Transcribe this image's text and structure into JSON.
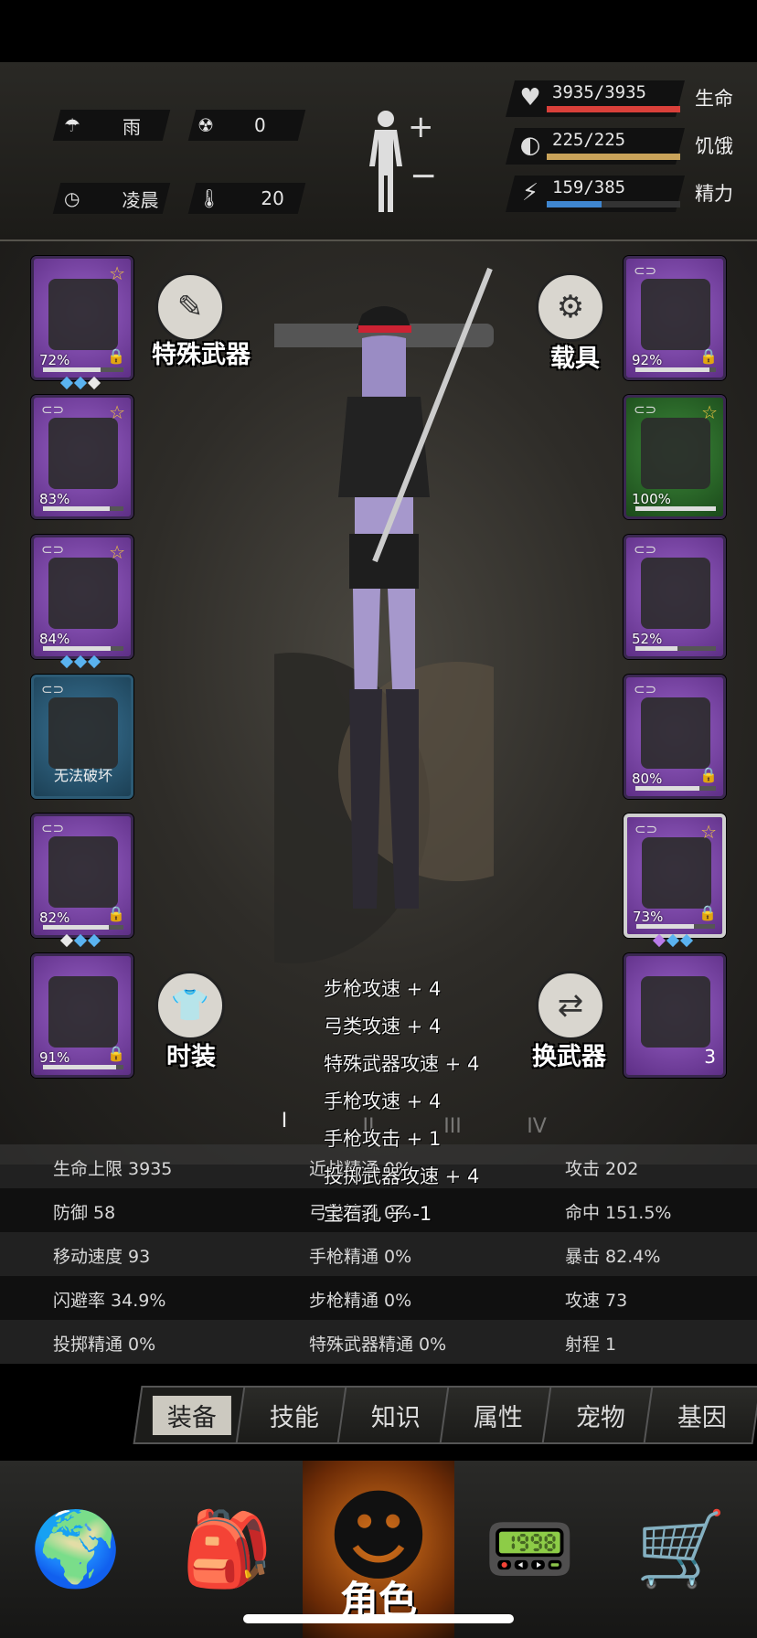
{
  "top": {
    "weather": {
      "icon": "rain-icon",
      "label": "雨"
    },
    "radiation": {
      "icon": "radiation-icon",
      "value": "0"
    },
    "time": {
      "icon": "clock-icon",
      "label": "凌晨"
    },
    "temperature": {
      "icon": "thermometer-icon",
      "value": "20"
    },
    "vitals": [
      {
        "name": "生命",
        "text": "3935/3935",
        "ratio": 1.0,
        "color": "#d9403a",
        "icon": "heart-icon"
      },
      {
        "name": "饥饿",
        "text": "225/225",
        "ratio": 1.0,
        "color": "#c9a35a",
        "icon": "stomach-icon"
      },
      {
        "name": "精力",
        "text": "159/385",
        "ratio": 0.41,
        "color": "#3f86d0",
        "icon": "energy-icon"
      }
    ]
  },
  "slots_left": [
    {
      "name": "helmet-slot",
      "pct": "72%",
      "durability": 0.72,
      "star": true,
      "lock": true,
      "gems": [
        "blue",
        "blue",
        "white"
      ]
    },
    {
      "name": "shirt-slot",
      "pct": "83%",
      "durability": 0.83,
      "star": true,
      "link": true
    },
    {
      "name": "jacket-slot",
      "pct": "84%",
      "durability": 0.84,
      "star": true,
      "link": true,
      "gems": [
        "blue",
        "blue",
        "blue"
      ]
    },
    {
      "name": "backpack-slot",
      "pct": "",
      "text": "无法破坏",
      "link": true
    },
    {
      "name": "pants-slot",
      "pct": "82%",
      "durability": 0.82,
      "link": true,
      "lock": true,
      "gems": [
        "white",
        "blue",
        "blue"
      ]
    },
    {
      "name": "boots-slot",
      "pct": "91%",
      "durability": 0.91,
      "lock": true
    }
  ],
  "slots_right": [
    {
      "name": "goggles-slot",
      "pct": "92%",
      "durability": 0.92,
      "link": true,
      "lock": true
    },
    {
      "name": "mask-slot",
      "pct": "100%",
      "durability": 1.0,
      "star": true,
      "link": true
    },
    {
      "name": "vest-slot",
      "pct": "52%",
      "durability": 0.52,
      "link": true
    },
    {
      "name": "shield-slot",
      "pct": "80%",
      "durability": 0.8,
      "link": true,
      "lock": true
    },
    {
      "name": "katana-slot",
      "pct": "73%",
      "durability": 0.73,
      "star": true,
      "link": true,
      "lock": true,
      "gems": [
        "purple",
        "blue",
        "blue"
      ]
    },
    {
      "name": "molotov-slot",
      "pct": "",
      "count": "3"
    }
  ],
  "buttons": {
    "special_weapon": "特殊武器",
    "vehicle": "载具",
    "fashion": "时装",
    "swap_weapon": "换武器"
  },
  "outfits": [
    "I",
    "II",
    "III",
    "IV"
  ],
  "tooltip": [
    "步枪攻速 + 4",
    "弓类攻速 + 4",
    "特殊武器攻速 + 4",
    "手枪攻速 + 4",
    "手枪攻击 + 1",
    "投掷武器攻速 + 4",
    "宝石孔 子 -1"
  ],
  "stats": [
    [
      "生命上限 3935",
      "近战精通 0%",
      "攻击 202"
    ],
    [
      "防御 58",
      "弓类精通 0%",
      "命中 151.5%"
    ],
    [
      "移动速度 93",
      "手枪精通 0%",
      "暴击 82.4%"
    ],
    [
      "闪避率 34.9%",
      "步枪精通 0%",
      "攻速 73"
    ],
    [
      "投掷精通 0%",
      "特殊武器精通 0%",
      "射程 1"
    ]
  ],
  "tabs": [
    "装备",
    "技能",
    "知识",
    "属性",
    "宠物",
    "基因"
  ],
  "nav": [
    {
      "icon": "globe-icon"
    },
    {
      "icon": "backpack-icon"
    },
    {
      "icon": "character-icon",
      "label": "角色"
    },
    {
      "icon": "radio-icon"
    },
    {
      "icon": "cart-icon"
    }
  ]
}
